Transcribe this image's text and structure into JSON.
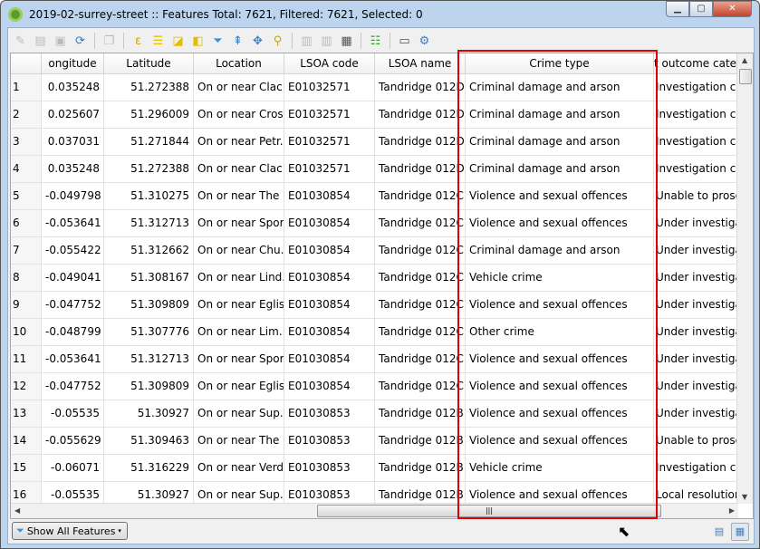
{
  "window": {
    "title": "2019-02-surrey-street :: Features Total: 7621, Filtered: 7621, Selected: 0",
    "minimize": "▁",
    "maximize": "▢",
    "close": "✕"
  },
  "toolbar": [
    "pencil-icon",
    "multi-edit-icon",
    "save-icon",
    "reload-icon",
    "copy-icon",
    "expression-select-icon",
    "select-all-icon",
    "invert-selection-icon",
    "deselect-icon",
    "filter-selected-icon",
    "move-top-icon",
    "pan-selected-icon",
    "zoom-selected-icon",
    "new-field-icon",
    "delete-field-icon",
    "field-calculator-icon",
    "conditional-format-icon",
    "dock-icon",
    "actions-icon"
  ],
  "columns": [
    "ongitude",
    "Latitude",
    "Location",
    "LSOA code",
    "LSOA name",
    "Crime type",
    "t outcome categ"
  ],
  "rows": [
    [
      "1",
      "0.035248",
      "51.272388",
      "On or near Clac...",
      "E01032571",
      "Tandridge 012D",
      "Criminal damage and arson",
      "Investigation c..."
    ],
    [
      "2",
      "0.025607",
      "51.296009",
      "On or near Cros...",
      "E01032571",
      "Tandridge 012D",
      "Criminal damage and arson",
      "Investigation c..."
    ],
    [
      "3",
      "0.037031",
      "51.271844",
      "On or near Petr...",
      "E01032571",
      "Tandridge 012D",
      "Criminal damage and arson",
      "Investigation c..."
    ],
    [
      "4",
      "0.035248",
      "51.272388",
      "On or near Clac...",
      "E01032571",
      "Tandridge 012D",
      "Criminal damage and arson",
      "Investigation c..."
    ],
    [
      "5",
      "-0.049798",
      "51.310275",
      "On or near The ...",
      "E01030854",
      "Tandridge 012C",
      "Violence and sexual offences",
      "Unable to prose..."
    ],
    [
      "6",
      "-0.053641",
      "51.312713",
      "On or near Spor...",
      "E01030854",
      "Tandridge 012C",
      "Violence and sexual offences",
      "Under investiga..."
    ],
    [
      "7",
      "-0.055422",
      "51.312662",
      "On or near Chu...",
      "E01030854",
      "Tandridge 012C",
      "Criminal damage and arson",
      "Under investiga..."
    ],
    [
      "8",
      "-0.049041",
      "51.308167",
      "On or near Lind...",
      "E01030854",
      "Tandridge 012C",
      "Vehicle crime",
      "Under investiga..."
    ],
    [
      "9",
      "-0.047752",
      "51.309809",
      "On or near Eglis...",
      "E01030854",
      "Tandridge 012C",
      "Violence and sexual offences",
      "Under investiga..."
    ],
    [
      "10",
      "-0.048799",
      "51.307776",
      "On or near Lim...",
      "E01030854",
      "Tandridge 012C",
      "Other crime",
      "Under investiga..."
    ],
    [
      "11",
      "-0.053641",
      "51.312713",
      "On or near Spor...",
      "E01030854",
      "Tandridge 012C",
      "Violence and sexual offences",
      "Under investiga..."
    ],
    [
      "12",
      "-0.047752",
      "51.309809",
      "On or near Eglis...",
      "E01030854",
      "Tandridge 012C",
      "Violence and sexual offences",
      "Under investiga..."
    ],
    [
      "13",
      "-0.05535",
      "51.30927",
      "On or near Sup...",
      "E01030853",
      "Tandridge 012B",
      "Violence and sexual offences",
      "Under investiga..."
    ],
    [
      "14",
      "-0.055629",
      "51.309463",
      "On or near The ...",
      "E01030853",
      "Tandridge 012B",
      "Violence and sexual offences",
      "Unable to prose..."
    ],
    [
      "15",
      "-0.06071",
      "51.316229",
      "On or near Verd...",
      "E01030853",
      "Tandridge 012B",
      "Vehicle crime",
      "Investigation c..."
    ],
    [
      "16",
      "-0.05535",
      "51.30927",
      "On or near Sup...",
      "E01030853",
      "Tandridge 012B",
      "Violence and sexual offences",
      "Local resolution"
    ]
  ],
  "footer": {
    "show_all": "Show All Features"
  },
  "highlight_color": "#e00000"
}
